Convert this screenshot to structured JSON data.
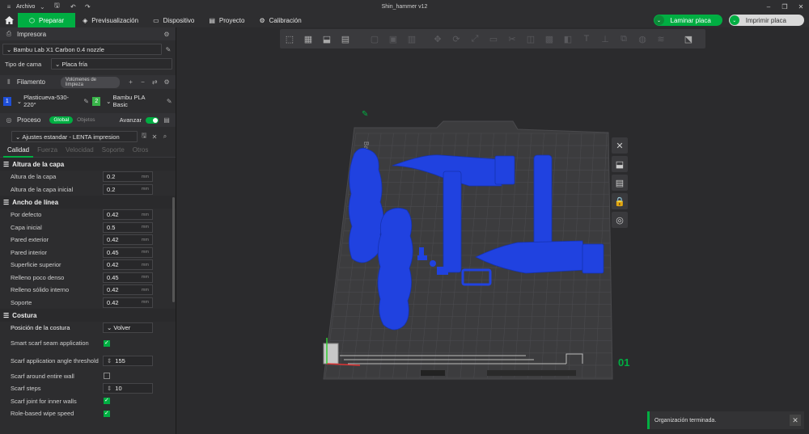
{
  "app": {
    "menu_label": "Archivo",
    "window_title": "Shin_hammer v12"
  },
  "nav": {
    "tabs": [
      {
        "label": "Preparar",
        "icon": "cube-icon"
      },
      {
        "label": "Previsualización",
        "icon": "layers-icon"
      },
      {
        "label": "Dispositivo",
        "icon": "monitor-icon"
      },
      {
        "label": "Proyecto",
        "icon": "folder-icon"
      },
      {
        "label": "Calibración",
        "icon": "gear-icon"
      }
    ],
    "active_tab": "Preparar",
    "slice_label": "Laminar placa",
    "print_label": "Imprimir placa"
  },
  "printer": {
    "section_label": "Impresora",
    "printer_value": "Bambu Lab X1 Carbon 0.4 nozzle",
    "bed_label": "Tipo de cama",
    "bed_value": "Placa fría"
  },
  "filament": {
    "section_label": "Filamento",
    "flush_label": "Volúmenes de limpieza",
    "items": [
      {
        "num": "1",
        "name": "Plasticueva-530-220°",
        "color": "#1f4fd8"
      },
      {
        "num": "2",
        "name": "Bambu PLA Basic",
        "color": "#39b54a"
      }
    ]
  },
  "process": {
    "section_label": "Proceso",
    "global_label": "Global",
    "objects_label": "Objetos",
    "advanced_label": "Avanzar",
    "preset_value": "Ajustes estandar - LENTA impresion",
    "tabs": [
      "Calidad",
      "Fuerza",
      "Velocidad",
      "Soporte",
      "Otros"
    ],
    "active_tab": "Calidad"
  },
  "params": {
    "layer_height_group": "Altura de la capa",
    "layer_height": {
      "label": "Altura de la capa",
      "value": "0.2",
      "unit": "mm"
    },
    "initial_layer_height": {
      "label": "Altura de la capa inicial",
      "value": "0.2",
      "unit": "mm"
    },
    "line_width_group": "Ancho de línea",
    "line_widths": [
      {
        "label": "Por defecto",
        "value": "0.42",
        "unit": "mm"
      },
      {
        "label": "Capa inicial",
        "value": "0.5",
        "unit": "mm"
      },
      {
        "label": "Pared exterior",
        "value": "0.42",
        "unit": "mm"
      },
      {
        "label": "Pared interior",
        "value": "0.45",
        "unit": "mm"
      },
      {
        "label": "Superficie superior",
        "value": "0.42",
        "unit": "mm"
      },
      {
        "label": "Relleno poco denso",
        "value": "0.45",
        "unit": "mm"
      },
      {
        "label": "Relleno sólido interno",
        "value": "0.42",
        "unit": "mm"
      },
      {
        "label": "Soporte",
        "value": "0.42",
        "unit": "mm"
      }
    ],
    "seam_group": "Costura",
    "seam_position": {
      "label": "Posición de la costura",
      "value": "Volver"
    },
    "smart_scarf": {
      "label": "Smart scarf seam application",
      "checked": true
    },
    "scarf_angle": {
      "label": "Scarf application angle threshold",
      "value": "155"
    },
    "scarf_entire_wall": {
      "label": "Scarf around entire wall",
      "checked": false
    },
    "scarf_steps": {
      "label": "Scarf steps",
      "value": "10"
    },
    "scarf_inner_walls": {
      "label": "Scarf joint for inner walls",
      "checked": true
    },
    "role_wipe_speed": {
      "label": "Role-based wipe speed",
      "checked": true
    }
  },
  "viewport": {
    "plate_number": "01",
    "plate_brand": "Bambu",
    "model_color": "#1f3fe0",
    "plate_color": "#3a3a3c"
  },
  "toast": {
    "message": "Organización terminada."
  }
}
